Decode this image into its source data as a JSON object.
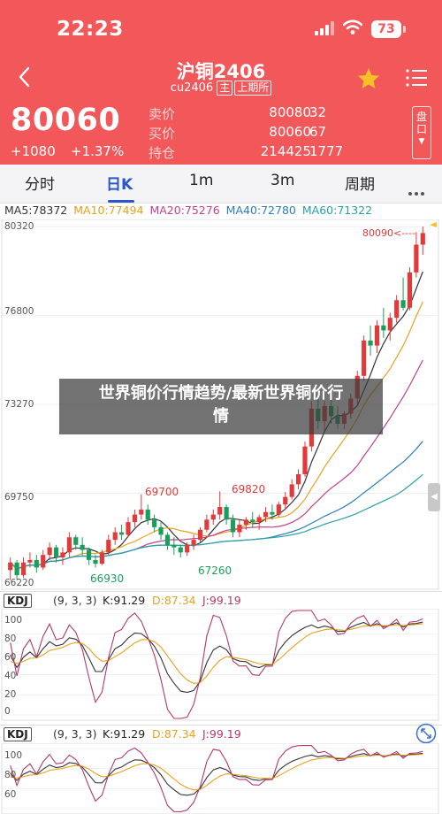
{
  "status": {
    "time": "22:23",
    "battery": "73"
  },
  "header": {
    "title": "沪铜2406",
    "code": "cu2406",
    "tag1": "主",
    "tag2": "上期所"
  },
  "quote": {
    "price": "80060",
    "change": "+1080",
    "change_pct": "+1.37%",
    "rows": [
      {
        "label": "卖价",
        "value": "80080",
        "qty": "32"
      },
      {
        "label": "买价",
        "value": "80060",
        "qty": "67"
      },
      {
        "label": "持仓",
        "value": "214425",
        "qty": "1777"
      }
    ],
    "side_btn": "盘口"
  },
  "tabs": [
    {
      "label": "分时"
    },
    {
      "label": "日K"
    },
    {
      "label": "1m"
    },
    {
      "label": "3m"
    },
    {
      "label": "周期"
    }
  ],
  "ma": {
    "ma5": "MA5:78372",
    "ma10": "MA10:77494",
    "ma20": "MA20:75276",
    "ma40": "MA40:72780",
    "ma60": "MA60:71322"
  },
  "colors": {
    "up": "#e23a3a",
    "down": "#1a9e5b",
    "ma5": "#333333",
    "ma10": "#e8a21c",
    "ma20": "#c2408e",
    "ma40": "#2e7fb8",
    "ma60": "#2aa0a8",
    "accent": "#f2575a",
    "tab_active": "#2a57c8"
  },
  "chart_data": {
    "type": "candlestick",
    "y_ticks": [
      "80320",
      "76800",
      "73270",
      "69750",
      "66220"
    ],
    "annotations": [
      "69700",
      "69820",
      "66930",
      "67260",
      "80090<----"
    ],
    "candles": [
      [
        66700,
        67200,
        66300,
        67000
      ],
      [
        67000,
        67100,
        66300,
        66500
      ],
      [
        66500,
        67200,
        66400,
        67000
      ],
      [
        67000,
        67400,
        66800,
        67100
      ],
      [
        67100,
        67300,
        66600,
        66800
      ],
      [
        66800,
        67500,
        66700,
        67300
      ],
      [
        67300,
        67800,
        67100,
        67600
      ],
      [
        67600,
        67700,
        67000,
        67200
      ],
      [
        67200,
        67600,
        66900,
        67400
      ],
      [
        67400,
        68200,
        67200,
        68000
      ],
      [
        68000,
        68100,
        67500,
        67700
      ],
      [
        67700,
        68000,
        67300,
        67500
      ],
      [
        67500,
        67600,
        66900,
        67100
      ],
      [
        67100,
        67300,
        66800,
        66950
      ],
      [
        66950,
        67500,
        66900,
        67400
      ],
      [
        67400,
        68100,
        67300,
        67900
      ],
      [
        67900,
        68400,
        67700,
        68200
      ],
      [
        68200,
        68500,
        67900,
        68100
      ],
      [
        68100,
        68800,
        68000,
        68600
      ],
      [
        68600,
        69100,
        68400,
        68900
      ],
      [
        68900,
        69700,
        68700,
        69100
      ],
      [
        69100,
        69300,
        68500,
        68700
      ],
      [
        68700,
        68900,
        68200,
        68400
      ],
      [
        68400,
        68600,
        67900,
        68100
      ],
      [
        68100,
        68200,
        67500,
        67700
      ],
      [
        67700,
        68000,
        67300,
        67600
      ],
      [
        67600,
        67700,
        67200,
        67400
      ],
      [
        67400,
        67800,
        67260,
        67700
      ],
      [
        67700,
        68100,
        67500,
        67900
      ],
      [
        67900,
        68400,
        67800,
        68300
      ],
      [
        68300,
        68900,
        68200,
        68700
      ],
      [
        68700,
        69100,
        68500,
        68900
      ],
      [
        68900,
        69820,
        68700,
        69200
      ],
      [
        69200,
        69300,
        68500,
        68700
      ],
      [
        68700,
        68900,
        68000,
        68200
      ],
      [
        68200,
        68700,
        68000,
        68500
      ],
      [
        68500,
        68800,
        68300,
        68700
      ],
      [
        68700,
        69000,
        68400,
        68600
      ],
      [
        68600,
        68900,
        68300,
        68800
      ],
      [
        68800,
        69200,
        68600,
        69000
      ],
      [
        69000,
        69300,
        68700,
        68900
      ],
      [
        68900,
        69400,
        68800,
        69300
      ],
      [
        69300,
        69800,
        69100,
        69600
      ],
      [
        69600,
        70300,
        69500,
        70100
      ],
      [
        70100,
        70700,
        69900,
        70500
      ],
      [
        70500,
        71800,
        70400,
        71600
      ],
      [
        71600,
        73400,
        71400,
        73100
      ],
      [
        73100,
        73600,
        72300,
        72600
      ],
      [
        72600,
        73400,
        72200,
        73200
      ],
      [
        73200,
        73500,
        72500,
        72800
      ],
      [
        72800,
        73200,
        72300,
        72500
      ],
      [
        72500,
        73000,
        72300,
        72900
      ],
      [
        72900,
        73700,
        72700,
        73500
      ],
      [
        73500,
        74600,
        73300,
        74400
      ],
      [
        74400,
        76000,
        74200,
        75800
      ],
      [
        75800,
        76400,
        75200,
        75600
      ],
      [
        75600,
        76600,
        75300,
        76400
      ],
      [
        76400,
        77100,
        75900,
        76200
      ],
      [
        76200,
        76900,
        75800,
        76700
      ],
      [
        76700,
        77600,
        76500,
        77400
      ],
      [
        77400,
        78300,
        77000,
        77100
      ],
      [
        77100,
        78700,
        77000,
        78500
      ],
      [
        78500,
        80100,
        78300,
        79600
      ],
      [
        79600,
        80320,
        79200,
        80060
      ]
    ]
  },
  "kdj": {
    "tag": "KDJ",
    "params": "(9, 3, 3)",
    "k": "K:91.29",
    "d": "D:87.34",
    "j": "J:99.19"
  },
  "kdj_ticks": [
    "100",
    "80",
    "60",
    "40",
    "20",
    "0"
  ],
  "kdj2_ticks": [
    "100",
    "80",
    "60"
  ],
  "overlay": {
    "line1": "世界铜价行情趋势/最新世界铜价行",
    "line2": "情"
  }
}
